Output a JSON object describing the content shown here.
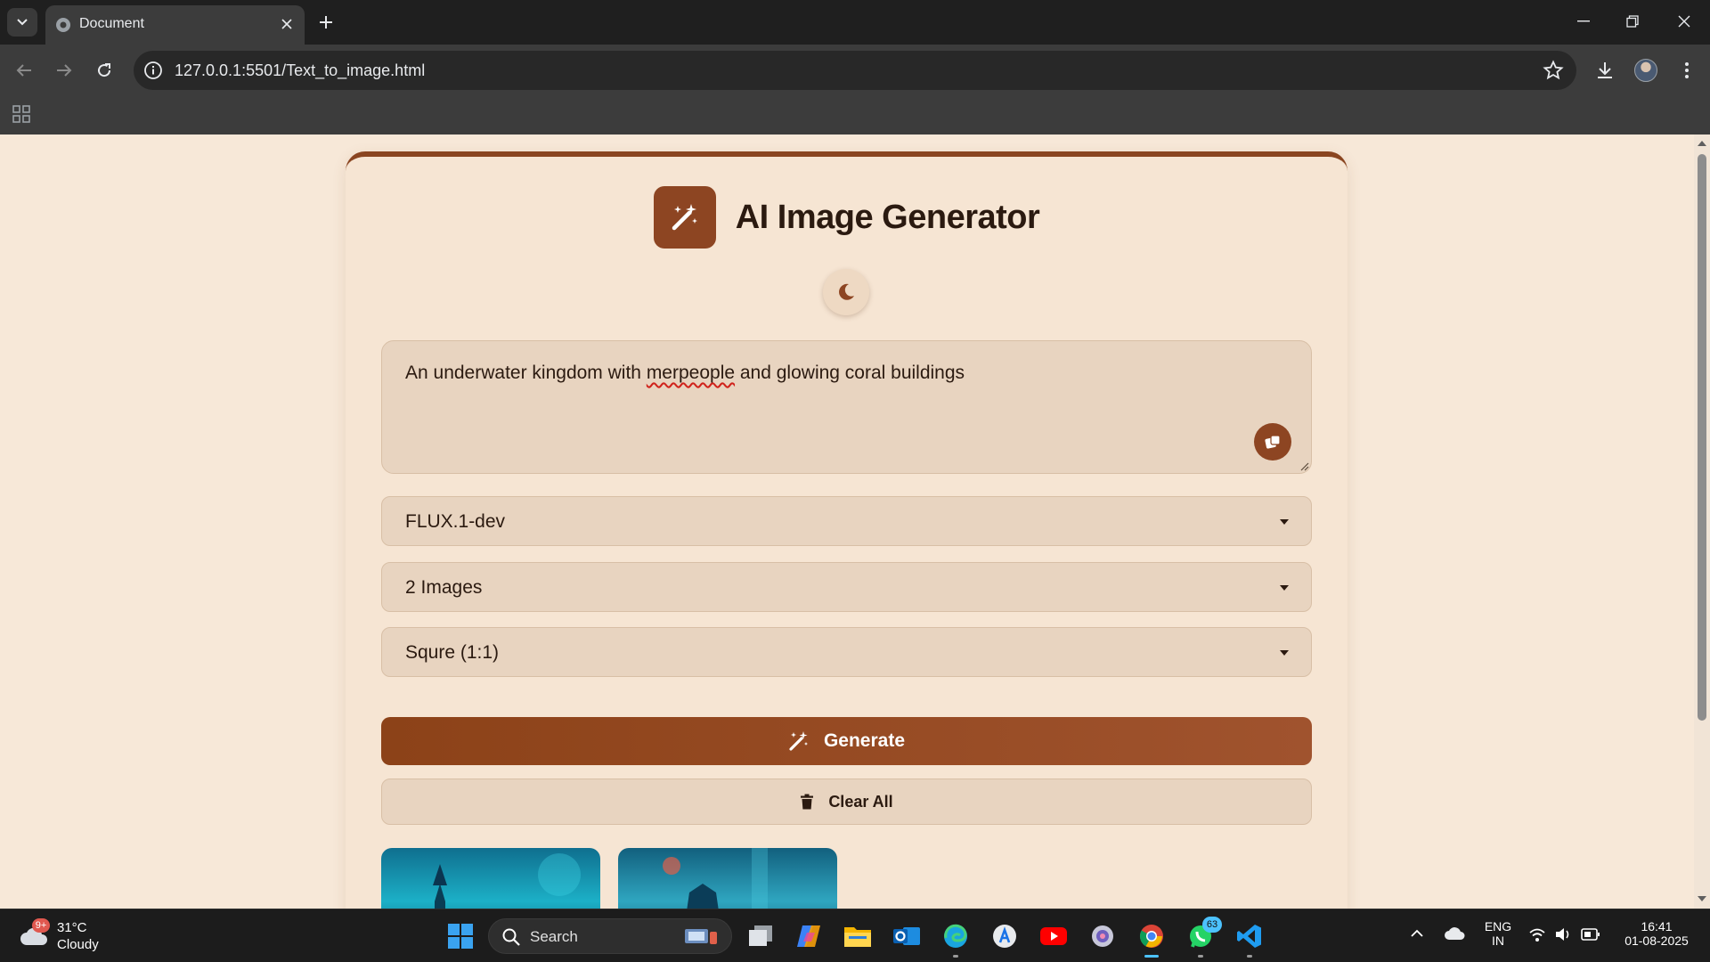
{
  "browser": {
    "tab_title": "Document",
    "url": "127.0.0.1:5501/Text_to_image.html"
  },
  "app": {
    "title": "AI Image Generator",
    "prompt_text_before": "An underwater kingdom with ",
    "prompt_text_misspelled": "merpeople",
    "prompt_text_after": " and glowing coral buildings",
    "model_select": {
      "selected": "FLUX.1-dev"
    },
    "count_select": {
      "selected": "2 Images"
    },
    "ratio_select": {
      "selected": "Squre (1:1)"
    },
    "generate_label": "Generate",
    "clear_label": "Clear All",
    "colors": {
      "accent": "#8d4522",
      "background": "#f7e8d8",
      "card": "#f6e5d3",
      "field": "#e8d4c0"
    }
  },
  "taskbar": {
    "weather": {
      "temp": "31°C",
      "condition": "Cloudy",
      "badge": "9+"
    },
    "search_label": "Search",
    "whatsapp_badge": "63",
    "language": {
      "line1": "ENG",
      "line2": "IN"
    },
    "clock": {
      "time": "16:41",
      "date": "01-08-2025"
    },
    "pinned_icons": [
      "windows-start-icon",
      "task-view-icon",
      "copilot-icon",
      "file-explorer-icon",
      "outlook-icon",
      "edge-icon",
      "app-store-icon",
      "youtube-icon",
      "browser-icon",
      "chrome-icon",
      "whatsapp-icon",
      "vscode-icon"
    ]
  }
}
